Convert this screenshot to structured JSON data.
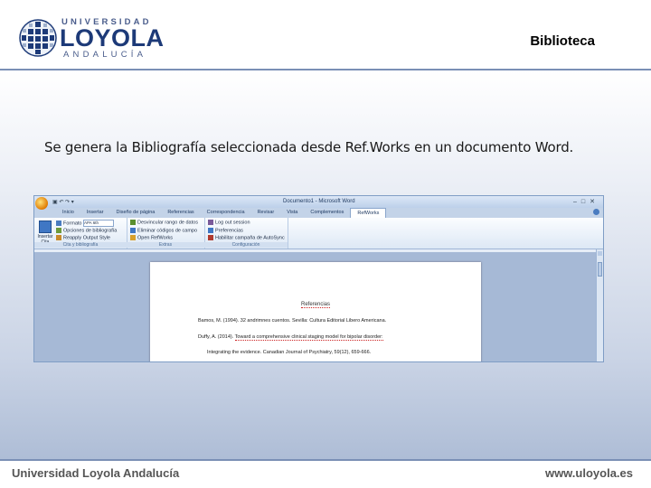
{
  "header": {
    "logo": {
      "top": "UNIVERSIDAD",
      "main": "LOYOLA",
      "bottom": "ANDALUCÍA"
    },
    "title": "Biblioteca"
  },
  "slide": {
    "subtitle": "Se genera la Bibliografía seleccionada desde Ref.Works en un documento Word."
  },
  "word": {
    "window_title": "Documento1 - Microsoft Word",
    "tabs": [
      "Inicio",
      "Insertar",
      "Diseño de página",
      "Referencias",
      "Correspondencia",
      "Revisar",
      "Vista",
      "Complementos",
      "RefWorks"
    ],
    "active_tab": "RefWorks",
    "ribbon": {
      "insert_label": "Insertar Cita",
      "format_label": "Formato",
      "format_value": "APA 6th",
      "bib_options": "Opciones de bibliografía",
      "reapply_style": "Reapply Output Style",
      "group_cita": "Cita y bibliografía",
      "remove_codes": "Desvincular rango de datos",
      "remove_field_codes": "Eliminar códigos de campo",
      "open_refworks": "Open RefWorks",
      "group_extras": "Extras",
      "log_out": "Log out session",
      "preferences": "Preferencias",
      "enable_autosync": "Habilitar campaña de AutoSync",
      "group_config": "Configuración"
    },
    "document": {
      "heading": "Referencias",
      "line1": "Bamos, M. (1994). 32 andrimnes cuentos. Sevilla: Cultura Editorial Libero Americana.",
      "line2_prefix": "Duffy, A. (2014).",
      "line2_link": "Toward a comprehensive clinical staging model for bipolar disorder:",
      "line3": "Integrating the evidence. Canadian Journal of Psychiatry, 59(12), 659-666."
    }
  },
  "footer": {
    "left": "Universidad Loyola Andalucía",
    "right": "www.uloyola.es"
  },
  "colors": {
    "brand_blue": "#1d3a78",
    "ribbon_blue": "#c3d3e8",
    "accent_gray": "#7a8fb5"
  }
}
